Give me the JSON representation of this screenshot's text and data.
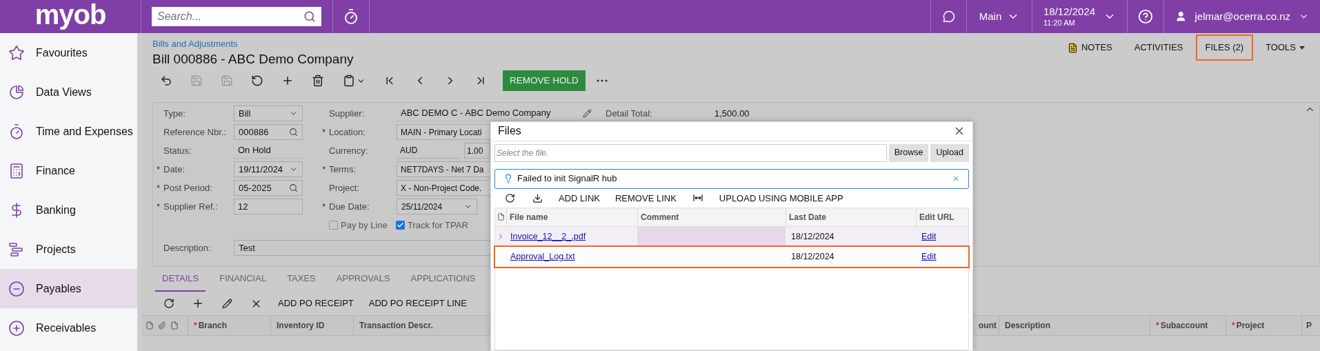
{
  "top_bar": {
    "logo": "myob",
    "search": {
      "placeholder": "Search..."
    },
    "company": "Main",
    "date": "18/12/2024",
    "time": "11:20 AM",
    "user": "jelmar@ocerra.co.nz"
  },
  "sidebar": {
    "items": [
      {
        "label": "Favourites",
        "selected": false
      },
      {
        "label": "Data Views",
        "selected": false
      },
      {
        "label": "Time and Expenses",
        "selected": false
      },
      {
        "label": "Finance",
        "selected": false
      },
      {
        "label": "Banking",
        "selected": false
      },
      {
        "label": "Projects",
        "selected": false
      },
      {
        "label": "Payables",
        "selected": true
      },
      {
        "label": "Receivables",
        "selected": false
      }
    ]
  },
  "page": {
    "breadcrumb": "Bills and Adjustments",
    "title": "Bill 000886 - ABC Demo Company",
    "links": [
      {
        "label": "NOTES",
        "kind": "notes",
        "highlighted": false
      },
      {
        "label": "ACTIVITIES",
        "kind": "plain",
        "highlighted": false
      },
      {
        "label": "FILES (2)",
        "kind": "plain",
        "highlighted": true
      },
      {
        "label": "TOOLS",
        "kind": "menu",
        "highlighted": false
      }
    ],
    "toolbar": [
      {
        "disabled": false
      },
      {
        "disabled": true
      },
      {
        "disabled": true
      },
      {
        "disabled": false
      },
      {
        "disabled": false
      },
      {
        "disabled": false
      },
      {
        "disabled": false
      },
      {
        "disabled": false
      },
      {
        "disabled": false
      },
      {
        "disabled": false
      },
      {
        "disabled": false
      }
    ],
    "action": "REMOVE HOLD"
  },
  "form": {
    "left": [
      {
        "label": "Type:",
        "kind": "select",
        "value": "Bill"
      },
      {
        "label": "Reference Nbr.:",
        "kind": "lookup",
        "value": "000886"
      },
      {
        "label": "Status:",
        "kind": "text",
        "value": "On Hold"
      },
      {
        "mark": "*",
        "label": "Date:",
        "kind": "select",
        "value": "19/11/2024"
      },
      {
        "mark": "*",
        "label": "Post Period:",
        "kind": "lookup",
        "value": "05-2025"
      },
      {
        "mark": "*",
        "label": "Supplier Ref.:",
        "kind": "input",
        "value": "12"
      }
    ],
    "middle": [
      {
        "label": "Supplier:",
        "kind": "text",
        "value": "ABC DEMO C - ABC Demo Company"
      },
      {
        "mark": "*",
        "label": "Location:",
        "kind": "input",
        "value": "MAIN - Primary Locati"
      },
      {
        "label": "Currency:",
        "kind": "currency",
        "value": "AUD",
        "rate": "1.00"
      },
      {
        "mark": "*",
        "label": "Terms:",
        "kind": "input",
        "value": "NET7DAYS - Net 7 Da"
      },
      {
        "label": "Project:",
        "kind": "input",
        "value": "X - Non-Project Code."
      },
      {
        "mark": "*",
        "label": "Due Date:",
        "kind": "select",
        "value": "25/11/2024"
      }
    ],
    "detail_total": {
      "label": "Detail Total:",
      "value": "1,500.00"
    },
    "checkboxes": [
      {
        "label": "Pay by Line",
        "checked": false
      },
      {
        "label": "Track for TPAR",
        "checked": true
      }
    ],
    "description": {
      "label": "Description:",
      "value": "Test"
    }
  },
  "tabs": [
    {
      "label": "DETAILS",
      "selected": true
    },
    {
      "label": "FINANCIAL",
      "selected": false
    },
    {
      "label": "TAXES",
      "selected": false
    },
    {
      "label": "APPROVALS",
      "selected": false
    },
    {
      "label": "APPLICATIONS",
      "selected": false
    }
  ],
  "grid": {
    "toolbar": [
      "ADD PO RECEIPT",
      "ADD PO RECEIPT LINE"
    ],
    "columns_left": [
      {
        "mark": "*",
        "label": "Branch"
      },
      {
        "label": "Inventory ID"
      },
      {
        "label": "Transaction Descr."
      }
    ],
    "columns_right": [
      {
        "label": "ount"
      },
      {
        "label": "Description"
      },
      {
        "mark": "*",
        "label": "Subaccount"
      },
      {
        "mark": "*",
        "label": "Project"
      },
      {
        "label": "P"
      }
    ]
  },
  "dialog": {
    "title": "Files",
    "file_placeholder": "Select the file.",
    "buttons": [
      "Browse",
      "Upload"
    ],
    "alert": "Failed to init SignalR hub",
    "toolbar": [
      {
        "kind": "refresh"
      },
      {
        "kind": "download"
      },
      {
        "kind": "text",
        "label": "ADD LINK"
      },
      {
        "kind": "text",
        "label": "REMOVE LINK"
      },
      {
        "kind": "fit"
      },
      {
        "kind": "text",
        "label": "UPLOAD USING MOBILE APP"
      }
    ],
    "columns": [
      "File name",
      "Comment",
      "Last Date",
      "Edit URL"
    ],
    "rows": [
      {
        "file": "Invoice_12__2_.pdf",
        "date": "18/12/2024",
        "edit": "Edit",
        "selected": true,
        "expandable": true,
        "highlighted": false
      },
      {
        "file": "Approval_Log.txt",
        "date": "18/12/2024",
        "edit": "Edit",
        "selected": false,
        "expandable": false,
        "highlighted": true
      }
    ]
  }
}
